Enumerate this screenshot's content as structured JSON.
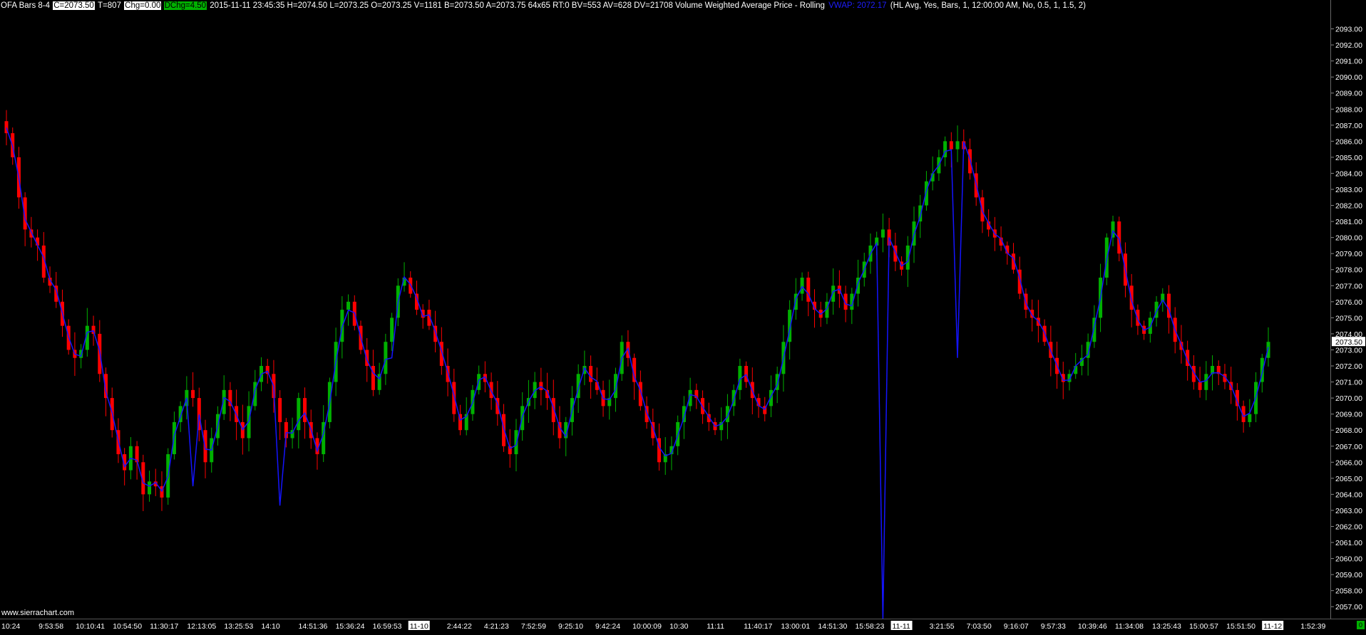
{
  "header": {
    "chart_title": "OFA Bars 8-4",
    "close": "C=2073.50",
    "trades": "T=807",
    "chg": "Chg=0.00",
    "dchg": "DChg=4.50",
    "bar_info": "2015-11-11 23:45:35 H=2074.50 L=2073.25 O=2073.25 V=1181 B=2073.50 A=2073.75 64x65 RT:0 BV=553 AV=628 DV=21708 Volume Weighted Average Price - Rolling",
    "vwap_value": "VWAP: 2072.17",
    "vwap_params": "(HL Avg, Yes, Bars, 1, 12:00:00 AM, No, 0.5, 1, 1.5, 2)"
  },
  "watermark": "www.sierrachart.com",
  "current_price_label": "2073.50",
  "corner_badge": "0",
  "colors": {
    "up": "#00b000",
    "down": "#ff0000",
    "vwap": "#1414ff",
    "background": "#000000",
    "price_highlight": "#ffffff"
  },
  "chart_data": {
    "type": "candlestick",
    "ylim": [
      2056.3,
      2094.0
    ],
    "y_ticks": [
      "2057.00",
      "2058.00",
      "2059.00",
      "2060.00",
      "2061.00",
      "2062.00",
      "2063.00",
      "2064.00",
      "2065.00",
      "2066.00",
      "2067.00",
      "2068.00",
      "2069.00",
      "2070.00",
      "2071.00",
      "2072.00",
      "2073.00",
      "2074.00",
      "2075.00",
      "2076.00",
      "2077.00",
      "2078.00",
      "2079.00",
      "2080.00",
      "2081.00",
      "2082.00",
      "2083.00",
      "2084.00",
      "2085.00",
      "2086.00",
      "2087.00",
      "2088.00",
      "2089.00",
      "2090.00",
      "2091.00",
      "2092.00",
      "2093.00"
    ],
    "x_tick_labels": [
      {
        "text": "10:24",
        "highlight": false
      },
      {
        "text": "9:53:58",
        "highlight": false
      },
      {
        "text": "10:10:41",
        "highlight": false
      },
      {
        "text": "10:54:50",
        "highlight": false
      },
      {
        "text": "11:30:17",
        "highlight": false
      },
      {
        "text": "12:13:05",
        "highlight": false
      },
      {
        "text": "13:25:53",
        "highlight": false
      },
      {
        "text": "14:10",
        "highlight": false
      },
      {
        "text": "14:51:36",
        "highlight": false
      },
      {
        "text": "15:36:24",
        "highlight": false
      },
      {
        "text": "16:59:53",
        "highlight": false
      },
      {
        "text": "11-10",
        "highlight": true
      },
      {
        "text": "2:44:22",
        "highlight": false
      },
      {
        "text": "4:21:23",
        "highlight": false
      },
      {
        "text": "7:52:59",
        "highlight": false
      },
      {
        "text": "9:25:10",
        "highlight": false
      },
      {
        "text": "9:42:24",
        "highlight": false
      },
      {
        "text": "10:00:09",
        "highlight": false
      },
      {
        "text": "10:30",
        "highlight": false
      },
      {
        "text": "11:11",
        "highlight": false
      },
      {
        "text": "11:40:17",
        "highlight": false
      },
      {
        "text": "13:00:01",
        "highlight": false
      },
      {
        "text": "14:51:30",
        "highlight": false
      },
      {
        "text": "15:58:23",
        "highlight": false
      },
      {
        "text": "11-11",
        "highlight": true
      },
      {
        "text": "3:21:55",
        "highlight": false
      },
      {
        "text": "7:03:50",
        "highlight": false
      },
      {
        "text": "9:16:07",
        "highlight": false
      },
      {
        "text": "9:57:33",
        "highlight": false
      },
      {
        "text": "10:39:46",
        "highlight": false
      },
      {
        "text": "11:34:08",
        "highlight": false
      },
      {
        "text": "13:25:43",
        "highlight": false
      },
      {
        "text": "15:00:57",
        "highlight": false
      },
      {
        "text": "15:51:50",
        "highlight": false
      },
      {
        "text": "11-12",
        "highlight": true
      },
      {
        "text": "1:52:39",
        "highlight": false
      }
    ],
    "close_path": [
      2086.5,
      2085.0,
      2082.5,
      2080.5,
      2080.0,
      2079.5,
      2077.5,
      2077.0,
      2076.0,
      2074.5,
      2073.0,
      2072.5,
      2073.0,
      2074.5,
      2074.0,
      2071.5,
      2070.0,
      2068.0,
      2066.5,
      2065.5,
      2067.0,
      2066.0,
      2064.0,
      2064.8,
      2064.5,
      2063.8,
      2066.5,
      2068.5,
      2069.5,
      2070.5,
      2070.0,
      2068.0,
      2066.0,
      2067.5,
      2069.0,
      2070.5,
      2069.5,
      2068.5,
      2067.5,
      2069.5,
      2071.0,
      2072.0,
      2071.5,
      2070.0,
      2068.5,
      2067.5,
      2068.0,
      2070.0,
      2068.5,
      2067.5,
      2066.5,
      2068.5,
      2071.0,
      2073.5,
      2075.5,
      2076.0,
      2074.5,
      2073.0,
      2072.0,
      2070.5,
      2071.5,
      2073.5,
      2075.0,
      2077.0,
      2077.5,
      2076.5,
      2075.5,
      2075.5,
      2074.5,
      2073.5,
      2072.0,
      2071.0,
      2069.0,
      2068.0,
      2069.0,
      2070.5,
      2071.5,
      2071.0,
      2070.0,
      2069.0,
      2067.0,
      2066.5,
      2068.0,
      2069.5,
      2070.0,
      2071.0,
      2070.5,
      2070.0,
      2068.5,
      2067.5,
      2068.5,
      2070.0,
      2071.5,
      2072.0,
      2071.0,
      2070.5,
      2069.5,
      2070.0,
      2071.5,
      2073.5,
      2072.5,
      2071.0,
      2069.5,
      2068.5,
      2067.5,
      2066.0,
      2066.5,
      2067.0,
      2068.5,
      2069.5,
      2070.5,
      2070.0,
      2069.0,
      2068.5,
      2068.0,
      2068.5,
      2069.5,
      2070.5,
      2072.0,
      2071.0,
      2070.0,
      2069.5,
      2069.5,
      2070.5,
      2071.5,
      2073.5,
      2075.5,
      2076.5,
      2077.5,
      2076.0,
      2075.5,
      2075.0,
      2076.0,
      2077.0,
      2076.5,
      2075.5,
      2076.5,
      2077.5,
      2078.5,
      2079.5,
      2080.0,
      2080.5,
      2079.5,
      2078.5,
      2078.0,
      2079.5,
      2081.0,
      2082.0,
      2083.5,
      2084.0,
      2085.0,
      2086.0,
      2085.5,
      2086.0,
      2085.5,
      2084.0,
      2082.5,
      2081.0,
      2080.5,
      2080.0,
      2079.5,
      2079.0,
      2078.0,
      2076.5,
      2075.5,
      2075.0,
      2074.5,
      2073.5,
      2072.5,
      2071.5,
      2071.0,
      2071.5,
      2072.0,
      2072.5,
      2073.5,
      2075.0,
      2077.5,
      2080.0,
      2081.0,
      2079.0,
      2077.0,
      2075.5,
      2074.5,
      2074.0,
      2075.0,
      2076.0,
      2076.5,
      2075.0,
      2073.5,
      2073.0,
      2072.0,
      2071.0,
      2070.5,
      2071.5,
      2072.0,
      2071.5,
      2071.0,
      2070.5,
      2069.5,
      2068.5,
      2069.0,
      2071.0,
      2072.5,
      2073.5
    ],
    "vwap_spikes": [
      {
        "bar": 30,
        "value": 2064.5
      },
      {
        "bar": 44,
        "value": 2063.3
      },
      {
        "bar": 62,
        "value": 2072.5
      },
      {
        "bar": 141,
        "value": 2056.2
      },
      {
        "bar": 153,
        "value": 2072.5
      }
    ]
  }
}
